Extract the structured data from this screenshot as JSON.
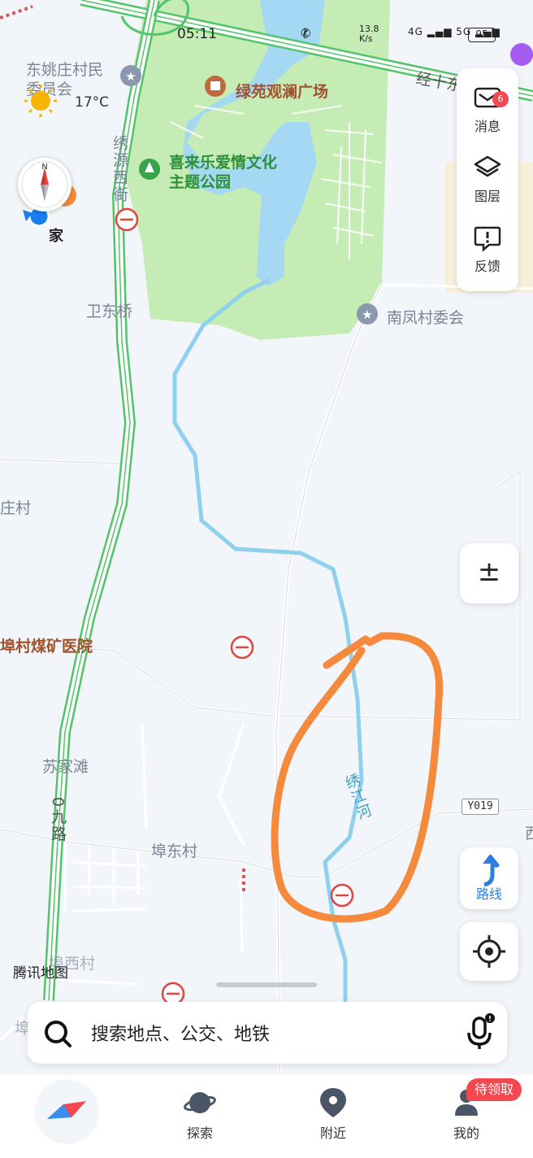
{
  "status_bar": {
    "time": "05:11",
    "net_speed_value": "13.8",
    "net_speed_unit": "K/s",
    "signal_1": "4G",
    "signal_2": "5G",
    "battery": "95"
  },
  "weather": {
    "temperature": "17°C",
    "icon": "sun-icon"
  },
  "compass": {
    "icon": "compass-icon",
    "north_label": "N"
  },
  "map_labels": {
    "dongyaozhuang": "东姚庄村民委员会",
    "lvyuan_square": "绿苑观澜广场",
    "xilaile_park": "喜来乐爱情文化主题公园",
    "xiuyuan_west_st": "绣源西街",
    "weidong_bridge": "卫东桥",
    "nanfeng_village": "南凤村委会",
    "home": "家",
    "zhuangcun": "庄村",
    "fucun_hospital": "埠村煤矿医院",
    "sujiatan": "苏家滩",
    "road_09": "0九路",
    "fudong_village": "埠东村",
    "fuxi_village": "埠西村",
    "xiujiang_river": "绣江河",
    "road_shi": "经十东路",
    "west_edge": "西",
    "fu_edge": "埠"
  },
  "road_sign": "Y019",
  "tools": {
    "messages_label": "消息",
    "messages_badge": "6",
    "layers_label": "图层",
    "feedback_label": "反馈"
  },
  "zoom_symbol": "±",
  "route_label": "路线",
  "watermark": "腾讯地图",
  "search": {
    "placeholder": "搜索地点、公交、地铁"
  },
  "bottom_nav": {
    "explore_label": "探索",
    "nearby_label": "附近",
    "mine_label": "我的",
    "reward_badge": "待领取"
  },
  "colors": {
    "park": "#c5ecb4",
    "water": "#a5d8f2",
    "river": "#8fd0ee",
    "road_green": "#52c46a",
    "annotation": "#f58a3c",
    "accent_blue": "#2a7de1",
    "badge_red": "#f4474f"
  }
}
